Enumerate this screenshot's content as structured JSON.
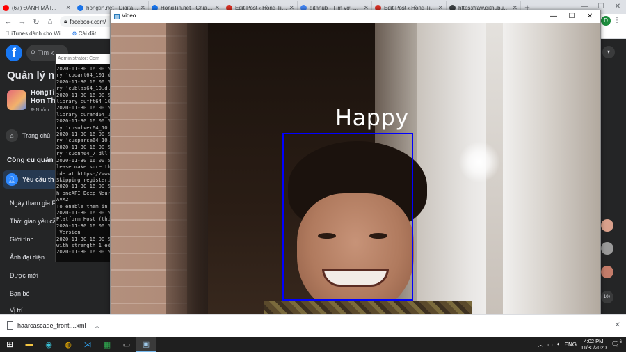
{
  "browser": {
    "tabs": [
      {
        "label": "(67) ĐÁNH MẤT...",
        "color": "#ff0000"
      },
      {
        "label": "hongtin.net - DigitalOc...",
        "color": "#1a73e8"
      },
      {
        "label": "HongTin.net - Chia Sẻ...",
        "color": "#1877f2"
      },
      {
        "label": "Edit Post ‹ Hồng Tin —...",
        "color": "#d93025"
      },
      {
        "label": "githhub - Tìm với Goo...",
        "color": "#4285f4"
      },
      {
        "label": "Edit Post ‹ Hồng Tin —...",
        "color": "#d93025"
      },
      {
        "label": "https://raw.githubuser...",
        "color": "#3c4043"
      }
    ],
    "new_tab": "+",
    "address": "facebook.com/",
    "profile_initial": "D",
    "bookmarks": [
      "iTunes dành cho Wi...",
      "Cài đặt"
    ]
  },
  "facebook": {
    "search_placeholder": "Tìm k",
    "page_title": "Quản lý nh",
    "group_name": "HongTi Hơn Th",
    "group_sub": "Nhóm",
    "home_label": "Trang chủ",
    "tools_header": "Công cụ quản t",
    "requests_label": "Yêu cầu th",
    "filters": [
      "Ngày tham gia F",
      "Thời gian yêu cầ",
      "Giới tính",
      "Ảnh đại diện",
      "Được mời",
      "Bạn bè",
      "Vị trí"
    ],
    "contact_badge": "10+"
  },
  "console": {
    "title": "Administrator: Com",
    "lines": [
      "2020-11-30 16:00:5",
      "ry 'cudart64_101.d",
      "2020-11-30 16:00:5",
      "ry 'cublas64_10.dl",
      "2020-11-30 16:00:5",
      "library cufft64_10.",
      "2020-11-30 16:00:5",
      "library curand64_1",
      "2020-11-30 16:00:5",
      "ry 'cusolver64_10.c",
      "2020-11-30 16:00:5",
      "ry 'cusparse64_10.",
      "2020-11-30 16:00:5",
      "ry 'cudnn64_7.dll'",
      "2020-11-30 16:00:5",
      "lease make sure the",
      "ide at https://www.",
      "Skipping registerin",
      "2020-11-30 16:00:5",
      "h oneAPI Deep Neur",
      "AVX2",
      "To enable them in ",
      "2020-11-30 16:00:5",
      "Platform Host (this",
      "2020-11-30 16:00:5",
      " Version",
      "2020-11-30 16:00:5",
      "with strength 1 edg",
      "2020-11-30 16:00:5"
    ]
  },
  "video_window": {
    "title": "Video",
    "minimize": "—",
    "maximize": "☐",
    "close": "✕",
    "emotion_label": "Happy",
    "box_color": "#0000ff"
  },
  "downloads": {
    "file_name": "haarcascade_front....xml"
  },
  "taskbar": {
    "lang": "ENG",
    "time": "4:02 PM",
    "date": "11/30/2020",
    "notif_count": "6"
  }
}
